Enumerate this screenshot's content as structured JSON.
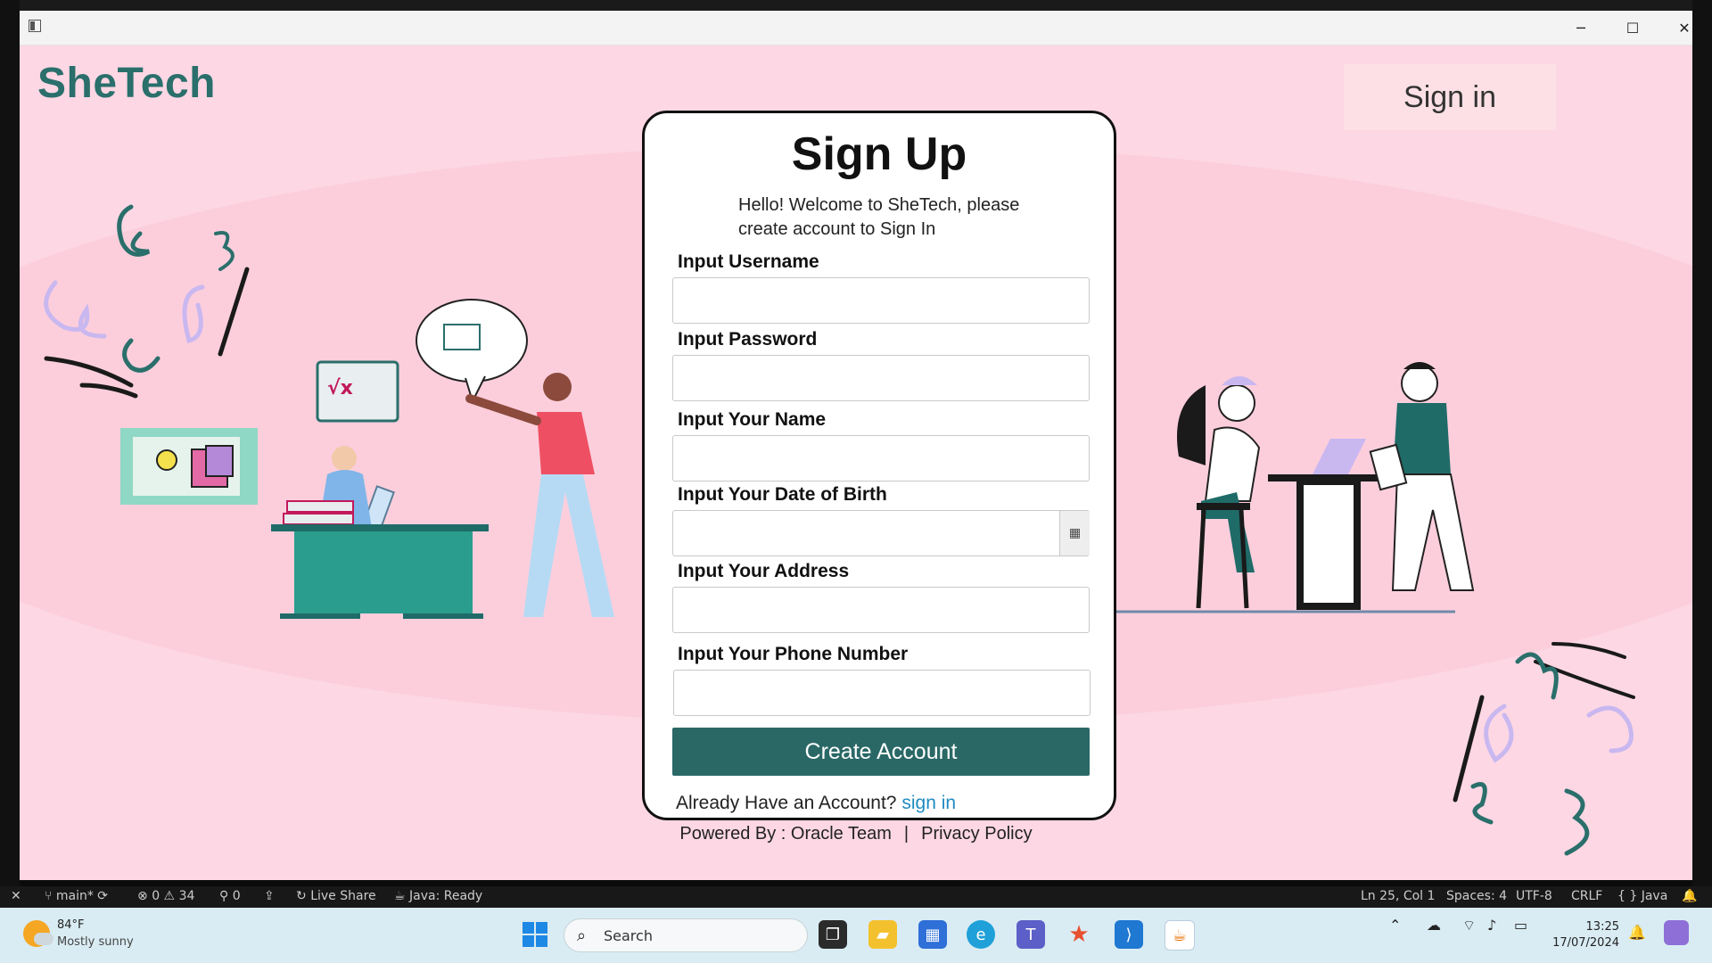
{
  "window": {
    "brand": "SheTech",
    "top_signin": "Sign in",
    "controls": {
      "minimize": "─",
      "maximize": "☐",
      "close": "✕"
    }
  },
  "form": {
    "title": "Sign Up",
    "subtitle_line1": "Hello! Welcome to SheTech, please",
    "subtitle_line2": "create account to Sign In",
    "fields": [
      {
        "label": "Input Username",
        "value": ""
      },
      {
        "label": "Input Password",
        "value": ""
      },
      {
        "label": "Input Your Name",
        "value": ""
      },
      {
        "label": "Input Your Date of Birth",
        "value": ""
      },
      {
        "label": "Input Your Address",
        "value": ""
      },
      {
        "label": "Input Your Phone Number",
        "value": ""
      }
    ],
    "date_picker_icon": "▦",
    "submit_label": "Create Account",
    "already_text": "Already Have an Account?",
    "signin_link": "sign in"
  },
  "footer": {
    "powered": "Powered By : Oracle Team",
    "separator": "|",
    "privacy": "Privacy Policy"
  },
  "colors": {
    "background": "#fdd7e4",
    "accent_teal": "#2a6866",
    "link": "#1f8ac0",
    "brand": "#2a6f6b"
  },
  "statusbar": {
    "branch": "main*",
    "errors": "0",
    "warnings": "34",
    "ports": "0",
    "live_share": "Live Share",
    "java_status": "Java: Ready",
    "cursor": "Ln 25, Col 1",
    "spaces": "Spaces: 4",
    "encoding": "UTF-8",
    "eol": "CRLF",
    "language": "{ } Java"
  },
  "taskbar": {
    "weather_temp": "84°F",
    "weather_desc": "Mostly sunny",
    "search_placeholder": "Search",
    "time": "13:25",
    "date": "17/07/2024"
  }
}
